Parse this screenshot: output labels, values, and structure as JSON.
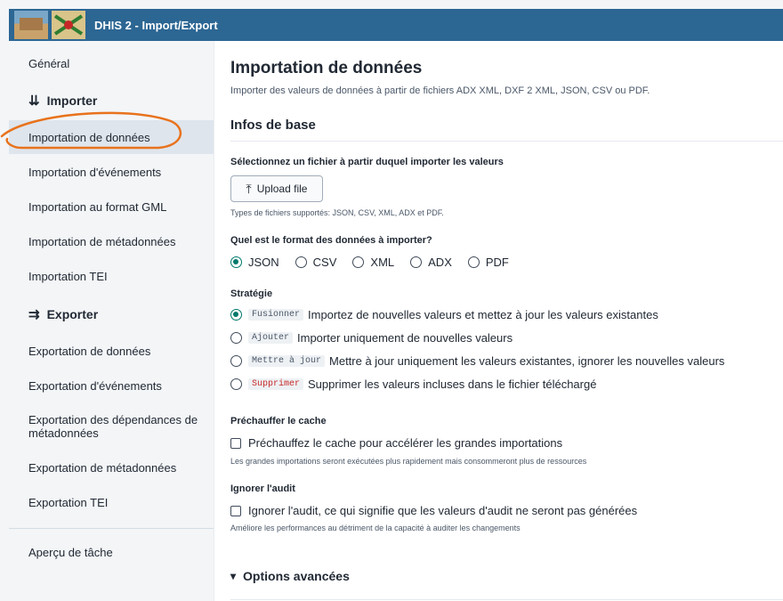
{
  "header": {
    "title": "DHIS 2 - Import/Export"
  },
  "sidebar": {
    "general": "Général",
    "import_heading": "Importer",
    "import_items": [
      "Importation de données",
      "Importation d'événements",
      "Importation au format GML",
      "Importation de métadonnées",
      "Importation TEI"
    ],
    "export_heading": "Exporter",
    "export_items": [
      "Exportation de données",
      "Exportation d'événements",
      "Exportation des dépendances de métadonnées",
      "Exportation de métadonnées",
      "Exportation TEI"
    ],
    "job_overview": "Aperçu de tâche",
    "active_item": "Importation de données"
  },
  "main": {
    "title": "Importation de données",
    "description": "Importer des valeurs de données à partir de fichiers ADX XML, DXF 2 XML, JSON, CSV ou PDF.",
    "section_title": "Infos de base",
    "file_label": "Sélectionnez un fichier à partir duquel importer les valeurs",
    "upload_button": "Upload file",
    "file_help": "Types de fichiers supportés: JSON, CSV, XML, ADX et PDF.",
    "format_label": "Quel est le format des données à importer?",
    "formats": [
      "JSON",
      "CSV",
      "XML",
      "ADX",
      "PDF"
    ],
    "selected_format": "JSON",
    "strategy_label": "Stratégie",
    "strategies": [
      {
        "code": "Fusionner",
        "text": "Importez de nouvelles valeurs et mettez à jour les valeurs existantes",
        "selected": true
      },
      {
        "code": "Ajouter",
        "text": "Importer uniquement de nouvelles valeurs",
        "selected": false
      },
      {
        "code": "Mettre à jour",
        "text": "Mettre à jour uniquement les valeurs existantes, ignorer les nouvelles valeurs",
        "selected": false
      },
      {
        "code": "Supprimer",
        "text": "Supprimer les valeurs incluses dans le fichier téléchargé",
        "selected": false
      }
    ],
    "preheat_label": "Préchauffer le cache",
    "preheat_checkbox": "Préchauffez le cache pour accélérer les grandes importations",
    "preheat_help": "Les grandes importations seront exécutées plus rapidement mais consommeront plus de ressources",
    "audit_label": "Ignorer l'audit",
    "audit_checkbox": "Ignorer l'audit, ce qui signifie que les valeurs d'audit ne seront pas générées",
    "audit_help": "Améliore les performances au détriment de la capacité à auditer les changements",
    "advanced": "Options avancées"
  },
  "colors": {
    "header": "#2c6693",
    "accent": "#00796b",
    "annotation": "#e8721c",
    "danger": "#c62828"
  },
  "icons": {
    "import": "import-icon",
    "export": "export-icon",
    "upload": "upload-icon",
    "chevron": "chevron-down-icon"
  }
}
